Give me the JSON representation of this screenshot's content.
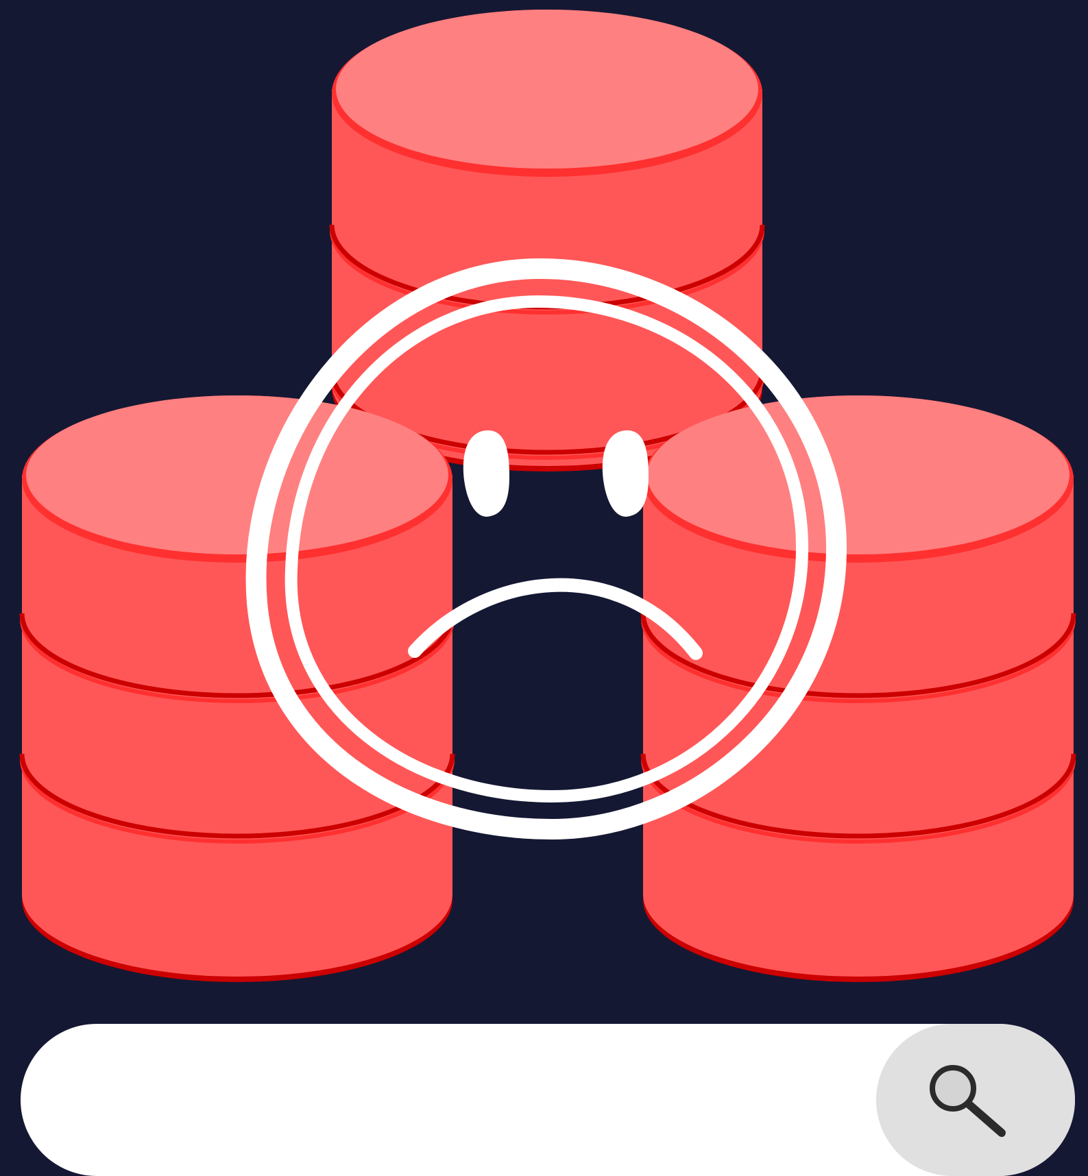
{
  "illustration": {
    "subject": "database-error",
    "icons": [
      "database-stack-icon",
      "sad-face-icon",
      "search-icon"
    ],
    "colors": {
      "background": "#151833",
      "cylinder_body": "#ff5757",
      "cylinder_top": "#ff8080",
      "cylinder_rim": "#ff3030",
      "cylinder_shadow": "#cc0000",
      "face_stroke": "#ffffff",
      "search_bar": "#ffffff",
      "search_button": "#e0e0e0",
      "magnifier": "#2b2b2b"
    }
  },
  "search": {
    "placeholder": "",
    "value": ""
  }
}
